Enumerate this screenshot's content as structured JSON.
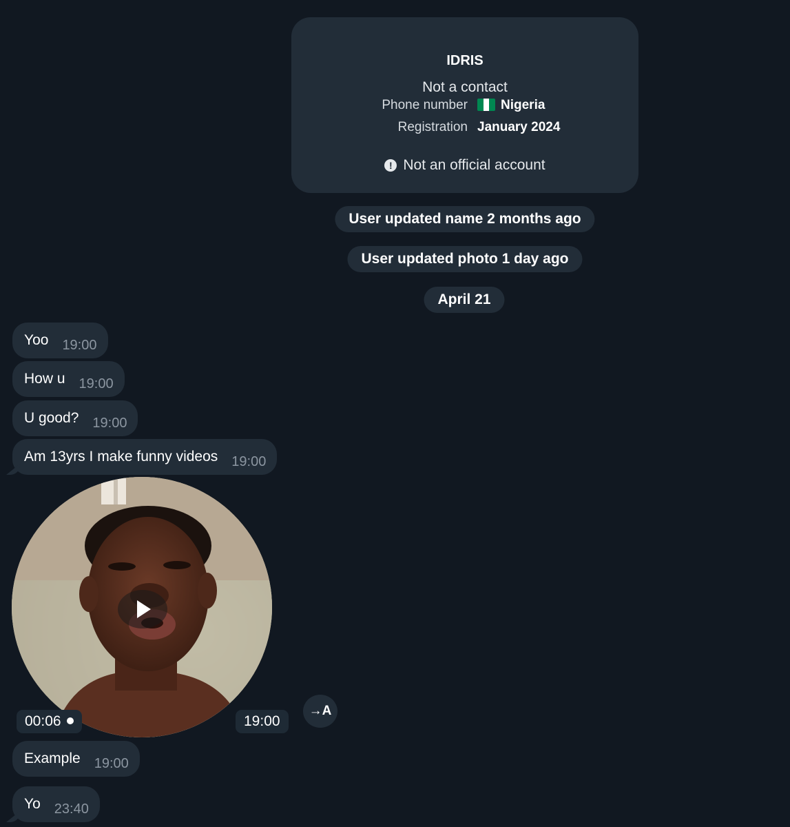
{
  "profile": {
    "name": "IDRIS",
    "status": "Not a contact",
    "phone_label": "Phone number",
    "phone_value": "Nigeria",
    "registration_label": "Registration",
    "registration_value": "January 2024",
    "warning": "Not an official account"
  },
  "service_messages": [
    "User updated name 2 months ago",
    "User updated photo 1 day ago",
    "April 21"
  ],
  "messages": [
    {
      "text": "Yoo",
      "time": "19:00"
    },
    {
      "text": "How u",
      "time": "19:00"
    },
    {
      "text": "U good?",
      "time": "19:00"
    },
    {
      "text": "Am 13yrs I make funny videos",
      "time": "19:00"
    },
    {
      "text": "Example",
      "time": "19:00"
    },
    {
      "text": "Yo",
      "time": "23:40"
    }
  ],
  "video_note": {
    "duration": "00:06",
    "time": "19:00",
    "translate_label": "→A"
  },
  "colors": {
    "background": "#111821",
    "bubble": "#222d38",
    "time_text": "#8c96a1",
    "nigeria_flag_green": "#008751"
  },
  "icons": [
    "exclamation-circle-icon",
    "nigeria-flag-icon",
    "play-icon",
    "translate-icon",
    "dot-icon"
  ]
}
